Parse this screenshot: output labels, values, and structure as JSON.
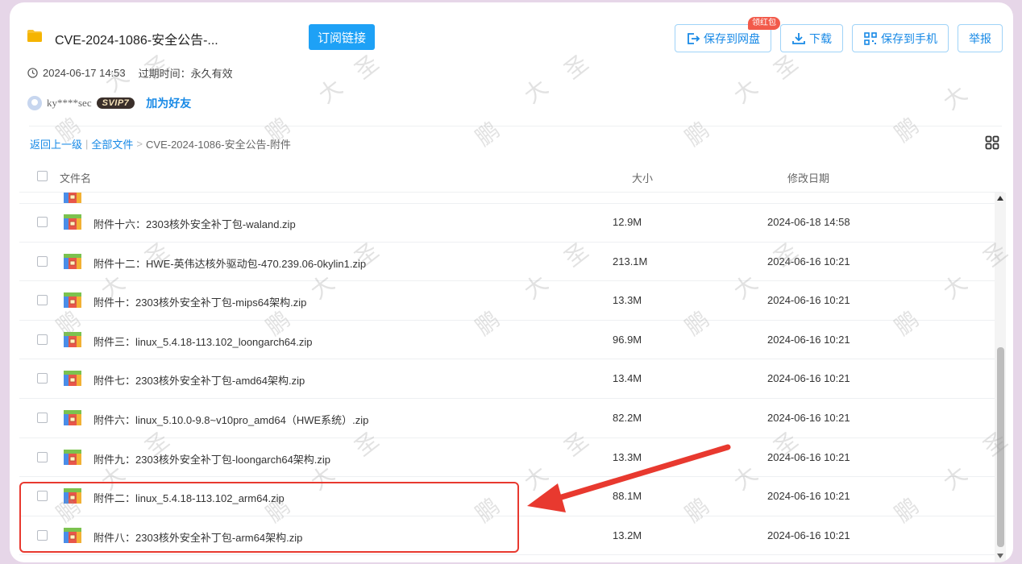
{
  "header": {
    "title": "CVE-2024-1086-安全公告-...",
    "subscribe_label": "订阅链接",
    "save_to_disk_label": "保存到网盘",
    "red_badge": "领红包",
    "download_label": "下载",
    "save_to_phone_label": "保存到手机",
    "report_label": "举报",
    "share_time": "2024-06-17 14:53",
    "expire_label": "过期时间：永久有效",
    "user_name": "ky****sec",
    "vip_badge": "SVIP7",
    "add_friend_label": "加为好友"
  },
  "breadcrumb": {
    "back": "返回上一级",
    "sep": "|",
    "all_files": "全部文件",
    "arrow": ">",
    "current": "CVE-2024-1086-安全公告-附件"
  },
  "table": {
    "col_name": "文件名",
    "col_size": "大小",
    "col_date": "修改日期",
    "rows": [
      {
        "name": "附件十六：2303核外安全补丁包-waland.zip",
        "size": "12.9M",
        "date": "2024-06-18 14:58"
      },
      {
        "name": "附件十二：HWE-英伟达核外驱动包-470.239.06-0kylin1.zip",
        "size": "213.1M",
        "date": "2024-06-16 10:21"
      },
      {
        "name": "附件十：2303核外安全补丁包-mips64架构.zip",
        "size": "13.3M",
        "date": "2024-06-16 10:21"
      },
      {
        "name": "附件三：linux_5.4.18-113.102_loongarch64.zip",
        "size": "96.9M",
        "date": "2024-06-16 10:21"
      },
      {
        "name": "附件七：2303核外安全补丁包-amd64架构.zip",
        "size": "13.4M",
        "date": "2024-06-16 10:21"
      },
      {
        "name": "附件六：linux_5.10.0-9.8~v10pro_amd64（HWE系统）.zip",
        "size": "82.2M",
        "date": "2024-06-16 10:21"
      },
      {
        "name": "附件九：2303核外安全补丁包-loongarch64架构.zip",
        "size": "13.3M",
        "date": "2024-06-16 10:21"
      },
      {
        "name": "附件二：linux_5.4.18-113.102_arm64.zip",
        "size": "88.1M",
        "date": "2024-06-16 10:21"
      },
      {
        "name": "附件八：2303核外安全补丁包-arm64架构.zip",
        "size": "13.2M",
        "date": "2024-06-16 10:21"
      }
    ]
  },
  "colors": {
    "accent": "#1ea1f6",
    "link": "#1789e6",
    "annotation_red": "#e8392f"
  },
  "watermark_glyphs": [
    "圣",
    "大",
    "鹏"
  ]
}
